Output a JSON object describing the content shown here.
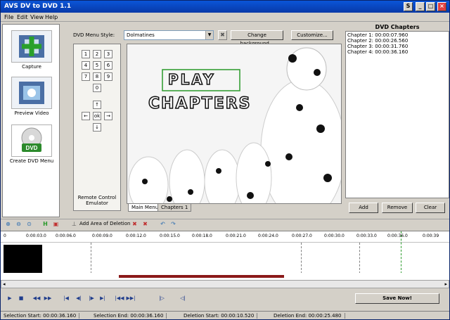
{
  "window": {
    "title": "AVS DV to DVD 1.1"
  },
  "menu": [
    "File",
    "Edit",
    "View",
    "Help"
  ],
  "sidebar": {
    "items": [
      {
        "label": "Capture",
        "icon": "film-plus-icon"
      },
      {
        "label": "Preview Video",
        "icon": "film-preview-icon"
      },
      {
        "label": "Create DVD Menu",
        "icon": "dvd-disc-icon"
      }
    ]
  },
  "menu_panel": {
    "style_label": "DVD Menu Style:",
    "style_value": "Dolmatines",
    "change_bg": "Change background...",
    "customize": "Customize...",
    "remote_label": "Remote Control Emulator",
    "keys": [
      "1",
      "2",
      "3",
      "4",
      "5",
      "6",
      "7",
      "8",
      "9",
      "0"
    ],
    "ok": "ok",
    "tabs": [
      "Main Menu",
      "Chapters 1"
    ],
    "preview_play": "PLAY",
    "preview_chapters": "CHAPTERS"
  },
  "chapters_panel": {
    "title": "DVD Chapters",
    "items": [
      "Chapter 1:  00:00:07.960",
      "Chapter 2:  00:00:26.560",
      "Chapter 3:  00:00:31.760",
      "Chapter 4:  00:00:36.160"
    ],
    "add": "Add",
    "remove": "Remove",
    "clear": "Clear"
  },
  "timeline": {
    "add_area": "Add Area of Deletion",
    "ticks": [
      "0",
      "0:00:03.0",
      "0:00:06.0",
      "0:00:09.0",
      "0:00:12.0",
      "0:00:15.0",
      "0:00:18.0",
      "0:00:21.0",
      "0:00:24.0",
      "0:00:27.0",
      "0:00:30.0",
      "0:00:33.0",
      "0:00:36.0",
      "0:00:39"
    ]
  },
  "save_label": "Save Now!",
  "status": {
    "sel_start": "Selection Start: 00:00:36.160",
    "sel_end": "Selection End: 00:00:36.160",
    "del_start": "Deletion Start: 00:00:10.520",
    "del_end": "Deletion End: 00:00:25.480"
  }
}
